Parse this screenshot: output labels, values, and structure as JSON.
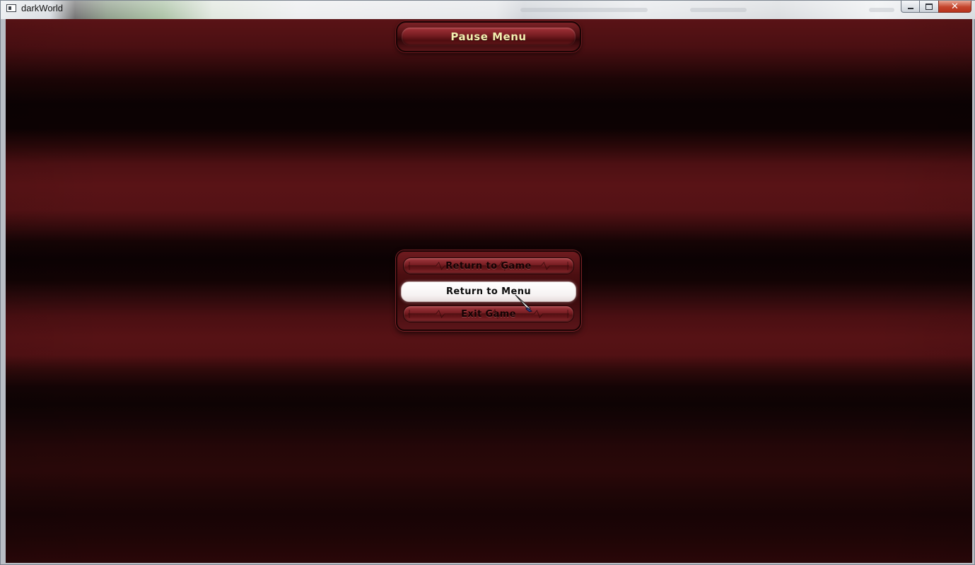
{
  "window": {
    "title": "darkWorld",
    "controls": {
      "minimize": "minimize",
      "maximize": "maximize",
      "close": "close"
    }
  },
  "pause_menu": {
    "title": "Pause Menu",
    "items": [
      {
        "label": "Return to Game",
        "state": "normal"
      },
      {
        "label": "Return to Menu",
        "state": "selected"
      },
      {
        "label": "Exit Game",
        "state": "normal"
      }
    ]
  },
  "theme": {
    "background": "#4a0f12",
    "title_text": "#f3efb0",
    "button_red": "#7b1f24",
    "selected_button": "#ffffff"
  },
  "icons": {
    "app": "app-window-icon",
    "cursor": "pen-cursor-icon",
    "button_decoration": "heartbeat-pulse-icon"
  }
}
